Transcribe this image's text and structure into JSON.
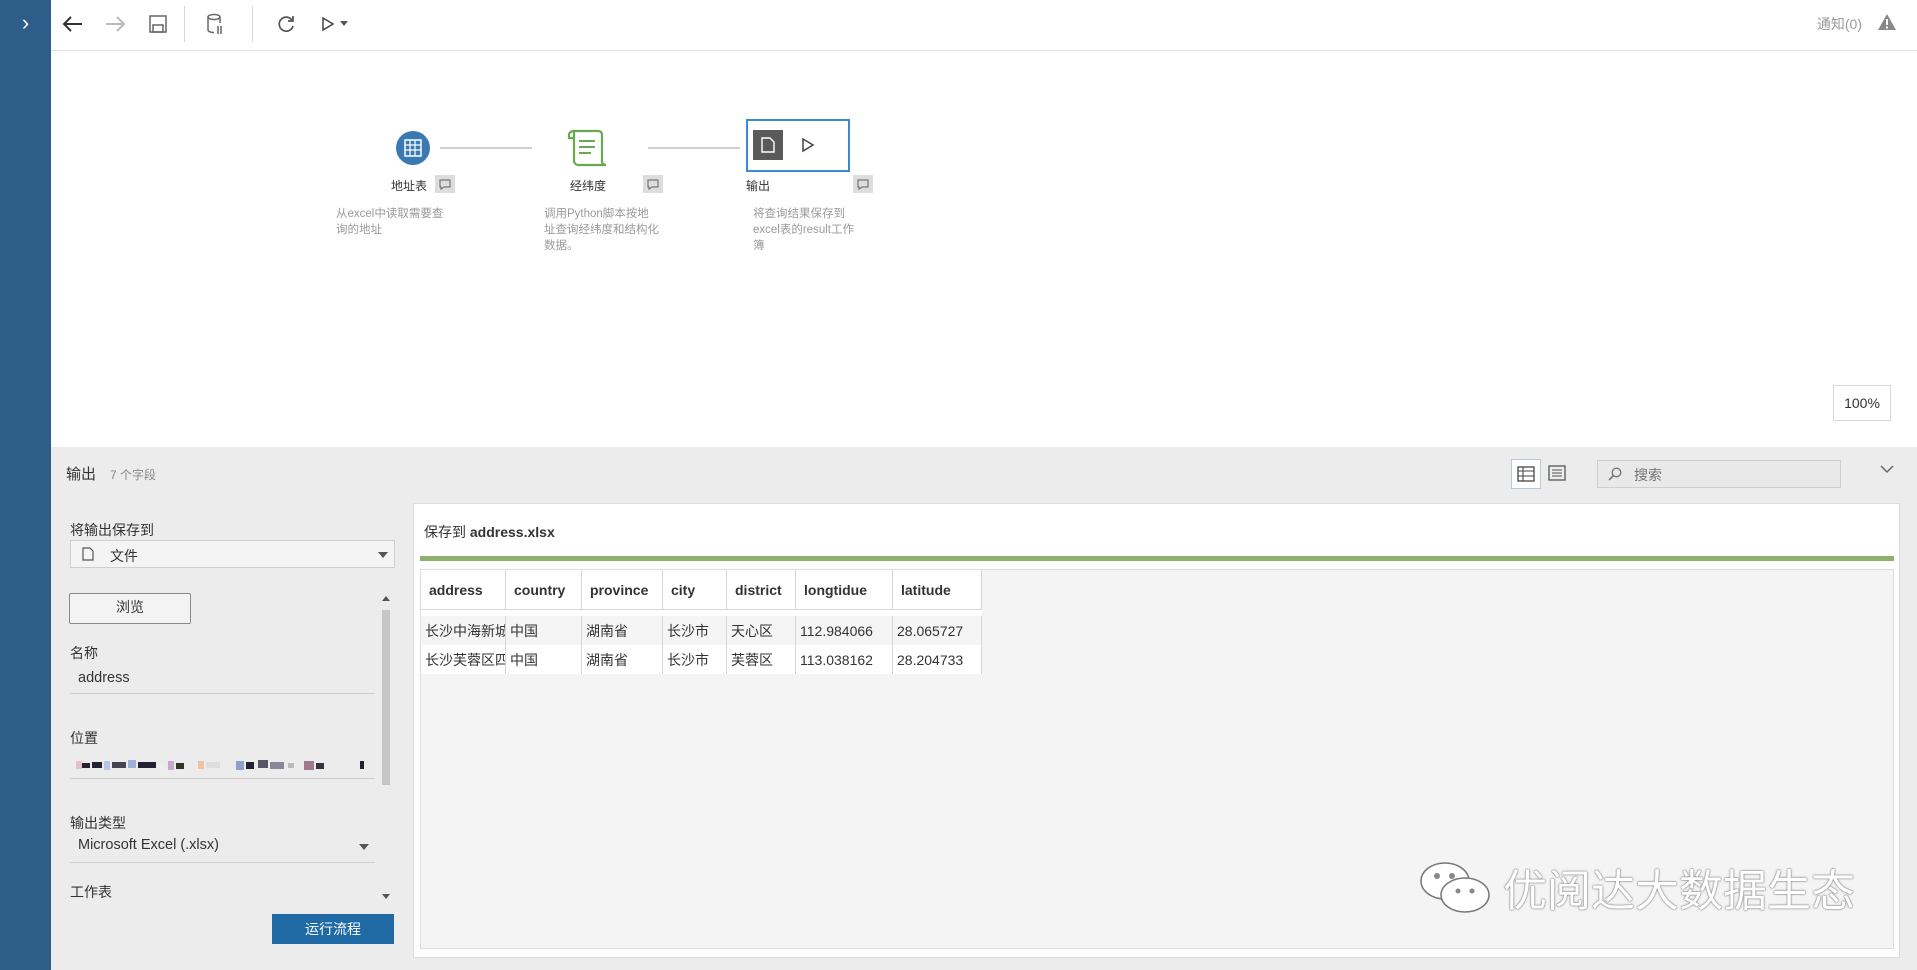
{
  "topbar": {
    "notify_label": "通知(0)"
  },
  "flow": {
    "nodes": [
      {
        "label": "地址表",
        "desc": [
          "从excel中读取需要查",
          "询的地址"
        ]
      },
      {
        "label": "经纬度",
        "desc": [
          "调用Python脚本按地",
          "址查询经纬度和结构化",
          "数据。"
        ]
      },
      {
        "label": "输出",
        "desc": [
          "将查询结果保存到",
          "excel表的result工作",
          "簿"
        ]
      }
    ],
    "zoom": "100%"
  },
  "panel": {
    "title": "输出",
    "field_count": "7 个字段",
    "search_placeholder": "搜索"
  },
  "left": {
    "save_to_label": "将输出保存到",
    "save_to_value": "文件",
    "browse_label": "浏览",
    "name_label": "名称",
    "name_value": "address",
    "location_label": "位置",
    "output_type_label": "输出类型",
    "output_type_value": "Microsoft Excel (.xlsx)",
    "worksheet_label": "工作表",
    "run_label": "运行流程"
  },
  "right": {
    "save_to_prefix": "保存到 ",
    "save_to_file": "address.xlsx",
    "table": {
      "headers": [
        "address",
        "country",
        "province",
        "city",
        "district",
        "longtidue",
        "latitude"
      ],
      "rows": [
        [
          "长沙中海新城",
          "中国",
          "湖南省",
          "长沙市",
          "天心区",
          "112.984066",
          "28.065727"
        ],
        [
          "长沙芙蓉区四",
          "中国",
          "湖南省",
          "长沙市",
          "芙蓉区",
          "113.038162",
          "28.204733"
        ]
      ]
    }
  },
  "watermark": "优阅达大数据生态",
  "colors": {
    "rail": "#2e5d8a",
    "run_button": "#1f6aa5",
    "progress": "#8db16a",
    "input_node": "#3a7ab3",
    "script_node": "#6aa84f"
  }
}
